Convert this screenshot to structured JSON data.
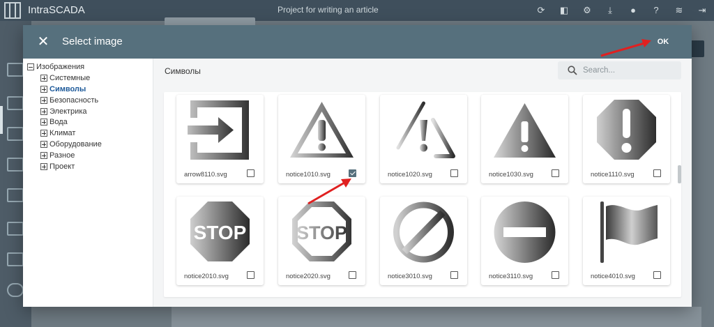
{
  "app": {
    "name": "IntraSCADA",
    "project": "Project for writing an article",
    "toolbar_icons": [
      "refresh-icon",
      "preview-icon",
      "settings-icon",
      "download-icon",
      "bug-icon",
      "help-icon",
      "wifi-icon",
      "logout-icon"
    ]
  },
  "dialog": {
    "title": "Select image",
    "close_label": "✕",
    "ok_label": "OK"
  },
  "tree": {
    "root": "Изображения",
    "children": [
      "Системные",
      "Символы",
      "Безопасность",
      "Электрика",
      "Вода",
      "Климат",
      "Оборудование",
      "Разное",
      "Проект"
    ],
    "selected": "Символы"
  },
  "content": {
    "category_title": "Символы",
    "search_placeholder": "Search..."
  },
  "images": [
    {
      "file": "arrow8110.svg",
      "icon": "arrow-right-icon",
      "checked": false
    },
    {
      "file": "notice1010.svg",
      "icon": "warning-triangle-outline-icon",
      "checked": true
    },
    {
      "file": "notice1020.svg",
      "icon": "warning-triangle-thin-icon",
      "checked": false
    },
    {
      "file": "notice1030.svg",
      "icon": "warning-triangle-solid-icon",
      "checked": false
    },
    {
      "file": "notice1110.svg",
      "icon": "warning-octagon-icon",
      "checked": false
    },
    {
      "file": "notice2010.svg",
      "icon": "stop-sign-solid-icon",
      "checked": false,
      "text": "STOP"
    },
    {
      "file": "notice2020.svg",
      "icon": "stop-sign-outline-icon",
      "checked": false,
      "text": "STOP"
    },
    {
      "file": "notice3010.svg",
      "icon": "prohibited-icon",
      "checked": false
    },
    {
      "file": "notice3110.svg",
      "icon": "no-entry-icon",
      "checked": false
    },
    {
      "file": "notice4010.svg",
      "icon": "flag-icon",
      "checked": false
    }
  ],
  "colors": {
    "header": "#56707d",
    "topbar": "#3f4f5c",
    "annotation_arrow": "#e02020",
    "selected_tree_item": "#1e5a9a"
  }
}
